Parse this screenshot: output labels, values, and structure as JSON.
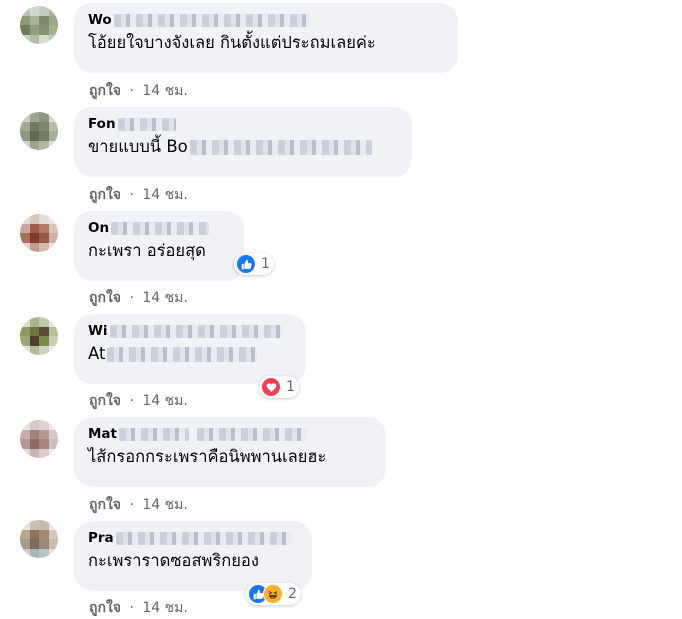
{
  "colors": {
    "bubble": "#f0f2f5",
    "text": "#050505",
    "secondary": "#65676b",
    "like_blue": "#1877f2",
    "love_red": "#f33e58",
    "haha_yellow": "#f7b125"
  },
  "action_like_label": "ถูกใจ",
  "comments": [
    {
      "author_visible": "Wo",
      "text_visible": "โอ้ยยใจบางจังเลย กินตั้งแต่ประถมเลยค่ะ",
      "like_label": "ถูกใจ",
      "separator": "·",
      "time": "14 ชม.",
      "reactions": null
    },
    {
      "author_visible": "Fon",
      "text_visible": "ขายแบบนี้ Bo",
      "like_label": "ถูกใจ",
      "separator": "·",
      "time": "14 ชม.",
      "reactions": null
    },
    {
      "author_visible": "On",
      "text_visible": "กะเพรา อร่อยสุด",
      "like_label": "ถูกใจ",
      "separator": "·",
      "time": "14 ชม.",
      "reactions": {
        "icons": [
          "like-icon"
        ],
        "count": "1"
      }
    },
    {
      "author_visible": "Wi",
      "text_visible": "At",
      "like_label": "ถูกใจ",
      "separator": "·",
      "time": "14 ชม.",
      "reactions": {
        "icons": [
          "love-icon"
        ],
        "count": "1"
      }
    },
    {
      "author_visible": "Mat",
      "text_visible": "ไส้กรอกกระเพราคือนิพพานเลยฮะ",
      "like_label": "ถูกใจ",
      "separator": "·",
      "time": "14 ชม.",
      "reactions": null
    },
    {
      "author_visible": "Pra",
      "text_visible": "กะเพราราดซอสพริกยอง",
      "like_label": "ถูกใจ",
      "separator": "·",
      "time": "14 ชม.",
      "reactions": {
        "icons": [
          "like-icon",
          "haha-icon"
        ],
        "count": "2"
      }
    }
  ]
}
